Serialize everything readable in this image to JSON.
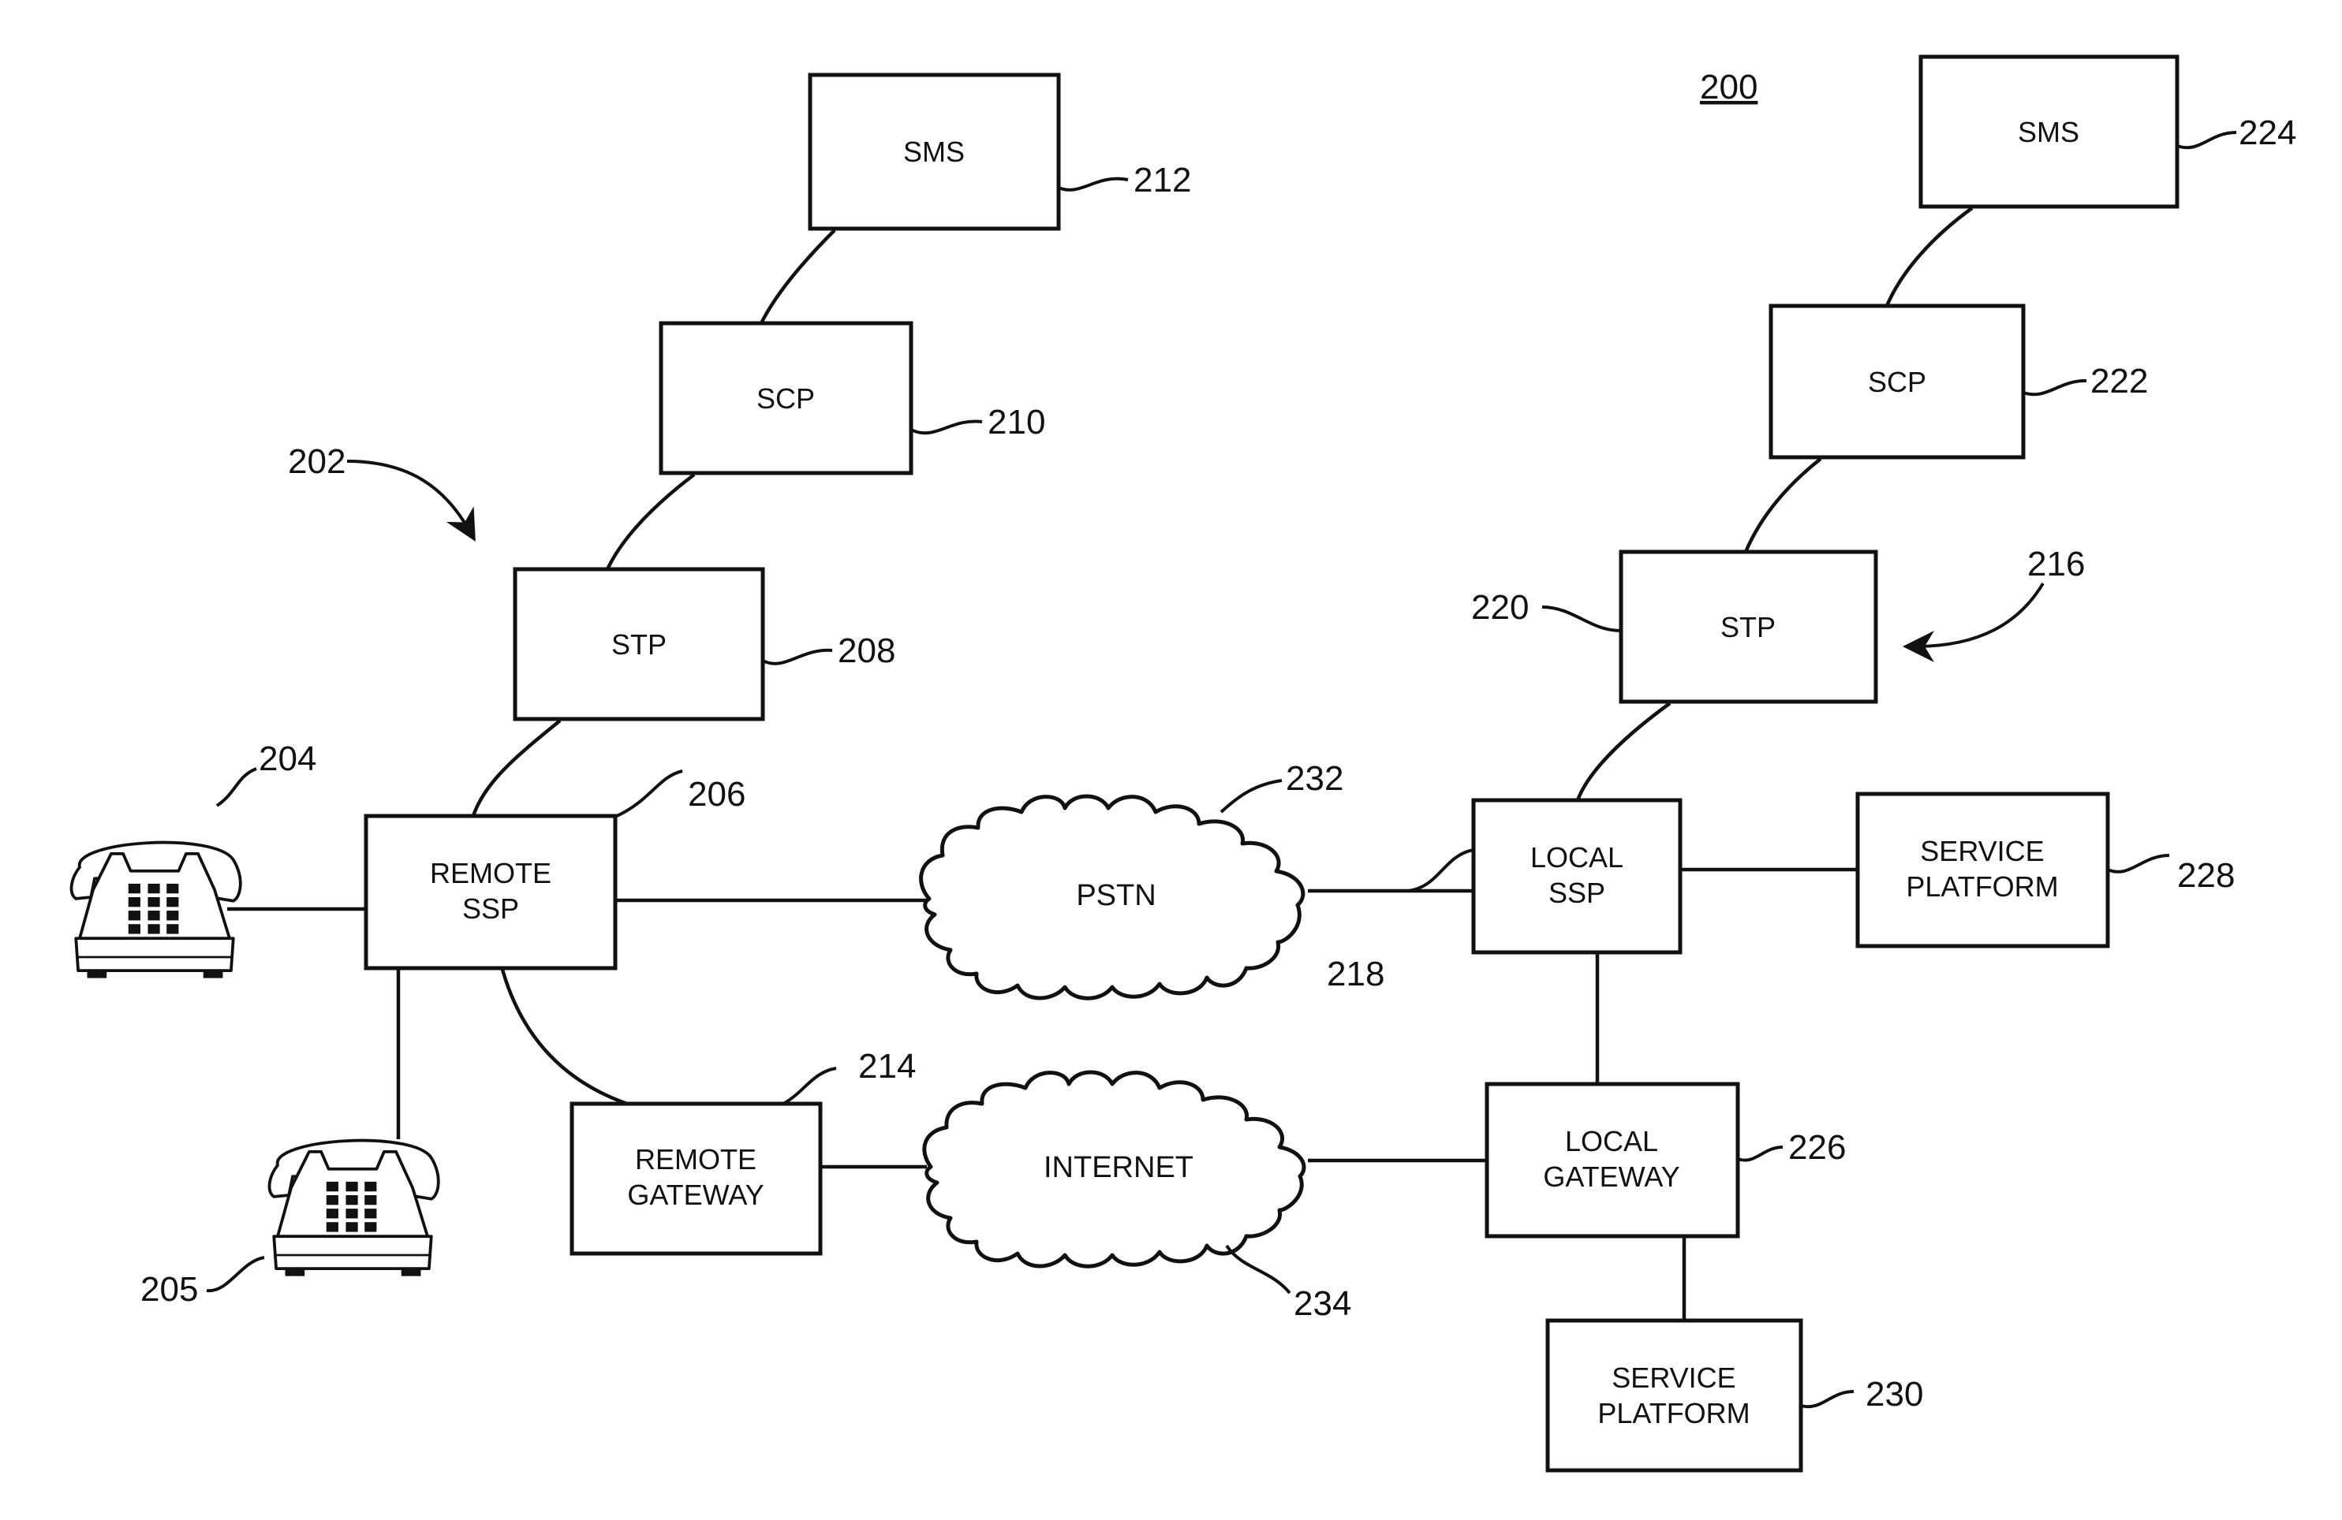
{
  "figure": {
    "ref": "200"
  },
  "remote_network": {
    "ref": "202",
    "sms": {
      "label": "SMS",
      "ref": "212"
    },
    "scp": {
      "label": "SCP",
      "ref": "210"
    },
    "stp": {
      "label": "STP",
      "ref": "208"
    },
    "ssp": {
      "label_line1": "REMOTE",
      "label_line2": "SSP",
      "ref": "206"
    },
    "gateway": {
      "label_line1": "REMOTE",
      "label_line2": "GATEWAY",
      "ref": "214"
    },
    "phone_a": {
      "ref": "204",
      "icon": "telephone-icon"
    },
    "phone_b": {
      "ref": "205",
      "icon": "telephone-icon"
    }
  },
  "local_network": {
    "ref": "216",
    "sms": {
      "label": "SMS",
      "ref": "224"
    },
    "scp": {
      "label": "SCP",
      "ref": "222"
    },
    "stp": {
      "label": "STP",
      "ref": "220"
    },
    "ssp": {
      "label_line1": "LOCAL",
      "label_line2": "SSP",
      "ref": "218"
    },
    "gateway": {
      "label_line1": "LOCAL",
      "label_line2": "GATEWAY",
      "ref": "226"
    },
    "service_platform_a": {
      "label_line1": "SERVICE",
      "label_line2": "PLATFORM",
      "ref": "228"
    },
    "service_platform_b": {
      "label_line1": "SERVICE",
      "label_line2": "PLATFORM",
      "ref": "230"
    }
  },
  "clouds": {
    "pstn": {
      "label": "PSTN",
      "ref": "232"
    },
    "internet": {
      "label": "INTERNET",
      "ref": "234"
    }
  }
}
